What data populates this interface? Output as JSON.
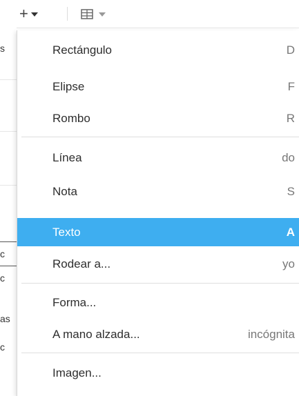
{
  "toolbar": {
    "add_icon": "plus-icon",
    "add_glyph": "+",
    "table_icon": "table-icon"
  },
  "canvas_fragments": [
    "s",
    "c",
    "c",
    "as",
    "c"
  ],
  "menu": {
    "items": [
      {
        "label": "Rectángulo",
        "shortcut": "D"
      },
      {
        "label": "Elipse",
        "shortcut": "F"
      },
      {
        "label": "Rombo",
        "shortcut": "R"
      },
      {
        "label": "Línea",
        "shortcut": "do"
      },
      {
        "label": "Nota",
        "shortcut": "S"
      },
      {
        "label": "Texto",
        "shortcut": "A",
        "selected": true
      },
      {
        "label": "Rodear a...",
        "shortcut": "yo"
      },
      {
        "label": "Forma...",
        "shortcut": ""
      },
      {
        "label": "A mano alzada...",
        "shortcut": "incógnita"
      },
      {
        "label": "Imagen...",
        "shortcut": ""
      }
    ]
  },
  "colors": {
    "selection": "#3eaef0",
    "separator": "#dedede"
  }
}
